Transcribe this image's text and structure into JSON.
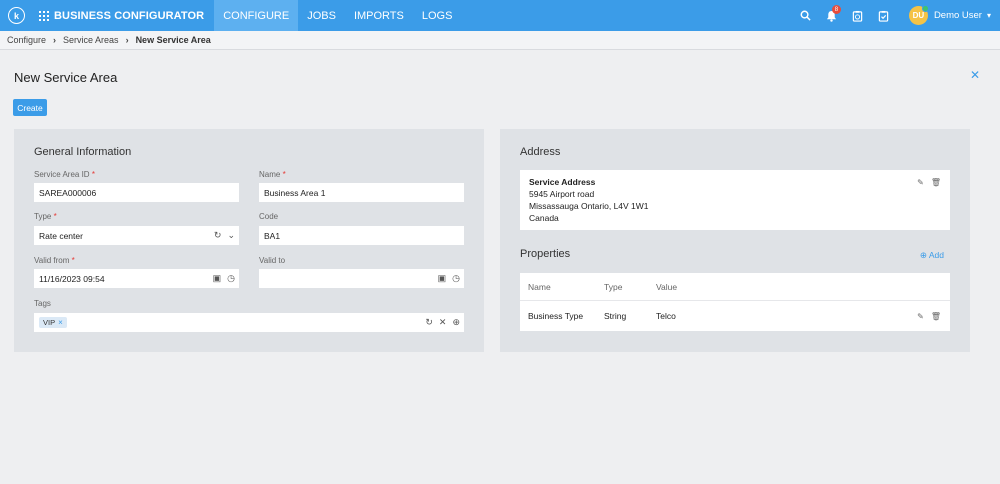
{
  "app": {
    "logo_letter": "k",
    "brand": "BUSINESS CONFIGURATOR",
    "nav_tabs": [
      "CONFIGURE",
      "JOBS",
      "IMPORTS",
      "LOGS"
    ],
    "notification_count": "8",
    "user_initials": "DU",
    "user_name": "Demo User"
  },
  "breadcrumb": [
    "Configure",
    "Service Areas",
    "New Service Area"
  ],
  "page": {
    "title": "New Service Area",
    "create_label": "Create"
  },
  "general": {
    "title": "General Information",
    "id_label": "Service Area ID",
    "id_value": "SAREA000006",
    "name_label": "Name",
    "name_value": "Business Area 1",
    "type_label": "Type",
    "type_value": "Rate center",
    "code_label": "Code",
    "code_value": "BA1",
    "valid_from_label": "Valid from",
    "valid_from_value": "11/16/2023 09:54",
    "valid_to_label": "Valid to",
    "valid_to_value": "",
    "tags_label": "Tags",
    "tags": [
      "VIP"
    ]
  },
  "address": {
    "title": "Address",
    "card_title": "Service Address",
    "line1": "5945 Airport road",
    "line2": "Missassauga Ontario, L4V 1W1",
    "line3": "Canada"
  },
  "properties": {
    "title": "Properties",
    "add_label": "Add",
    "columns": [
      "Name",
      "Type",
      "Value"
    ],
    "rows": [
      {
        "name": "Business Type",
        "type": "String",
        "value": "Telco"
      }
    ]
  },
  "colors": {
    "accent": "#3b9ce8",
    "required": "#e53935",
    "panel": "#dfe2e6"
  }
}
